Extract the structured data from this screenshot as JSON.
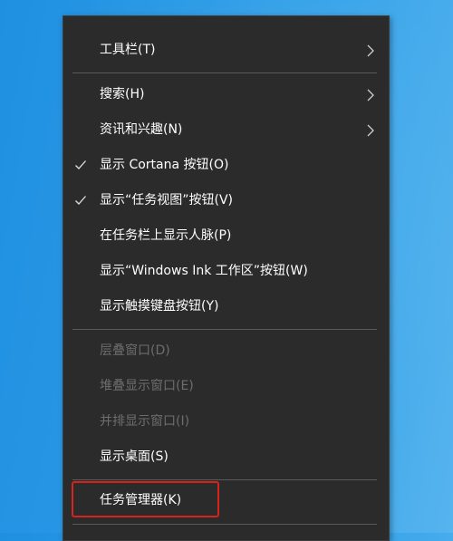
{
  "menu": {
    "items": [
      {
        "label": "工具栏(T)",
        "submenu": true,
        "checked": false,
        "disabled": false
      },
      {
        "label": "搜索(H)",
        "submenu": true,
        "checked": false,
        "disabled": false
      },
      {
        "label": "资讯和兴趣(N)",
        "submenu": true,
        "checked": false,
        "disabled": false
      },
      {
        "label": "显示 Cortana 按钮(O)",
        "submenu": false,
        "checked": true,
        "disabled": false
      },
      {
        "label": "显示“任务视图”按钮(V)",
        "submenu": false,
        "checked": true,
        "disabled": false
      },
      {
        "label": "在任务栏上显示人脉(P)",
        "submenu": false,
        "checked": false,
        "disabled": false
      },
      {
        "label": "显示“Windows Ink 工作区”按钮(W)",
        "submenu": false,
        "checked": false,
        "disabled": false
      },
      {
        "label": "显示触摸键盘按钮(Y)",
        "submenu": false,
        "checked": false,
        "disabled": false
      },
      {
        "label": "层叠窗口(D)",
        "submenu": false,
        "checked": false,
        "disabled": true
      },
      {
        "label": "堆叠显示窗口(E)",
        "submenu": false,
        "checked": false,
        "disabled": true
      },
      {
        "label": "并排显示窗口(I)",
        "submenu": false,
        "checked": false,
        "disabled": true
      },
      {
        "label": "显示桌面(S)",
        "submenu": false,
        "checked": false,
        "disabled": false
      },
      {
        "label": "任务管理器(K)",
        "submenu": false,
        "checked": false,
        "disabled": false,
        "highlighted": true
      }
    ]
  },
  "colors": {
    "desktop": "#2a9ae6",
    "menu_bg": "#2b2b2b",
    "text": "#ffffff",
    "disabled_text": "#6d6d6d",
    "separator": "#5a5a5a",
    "highlight_border": "#d9221c"
  },
  "icons": {
    "submenu": "chevron-right-icon",
    "check": "checkmark-icon"
  }
}
